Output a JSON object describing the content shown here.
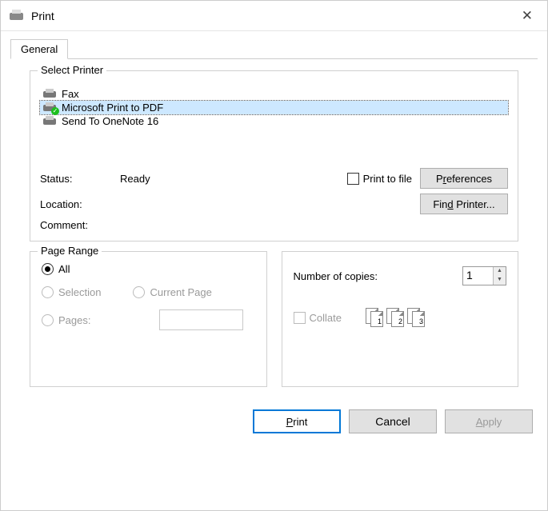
{
  "title": "Print",
  "close_label": "✕",
  "tab_label": "General",
  "select_printer_legend": "Select Printer",
  "printers": [
    {
      "name": "Fax",
      "selected": false,
      "ok": false
    },
    {
      "name": "Microsoft Print to PDF",
      "selected": true,
      "ok": true
    },
    {
      "name": "Send To OneNote 16",
      "selected": false,
      "ok": false
    }
  ],
  "status": {
    "label": "Status:",
    "value": "Ready"
  },
  "location_label": "Location:",
  "comment_label": "Comment:",
  "print_to_file_label": "Print to file",
  "preferences_label_pre": "P",
  "preferences_label_u": "r",
  "preferences_label_post": "eferences",
  "find_printer_label_pre": "Fin",
  "find_printer_label_u": "d",
  "find_printer_label_post": " Printer...",
  "page_range_legend": "Page Range",
  "all_label_u": "l",
  "all_label_pre": "A",
  "all_label_post": "l",
  "selection_label": "Selection",
  "current_page_label_pre": "C",
  "current_page_label_u": "u",
  "current_page_label_post": "rrent Page",
  "pages_label": "Pages:",
  "copies_label_pre": "Number of ",
  "copies_label_u": "c",
  "copies_label_post": "opies:",
  "copies_value": "1",
  "collate_label_pre": "C",
  "collate_label_u": "o",
  "collate_label_post": "llate",
  "collate_icons": [
    "1",
    "1",
    "2",
    "2",
    "3",
    "3"
  ],
  "footer": {
    "print_u": "P",
    "print_post": "rint",
    "cancel": "Cancel",
    "apply_u": "A",
    "apply_post": "pply"
  }
}
